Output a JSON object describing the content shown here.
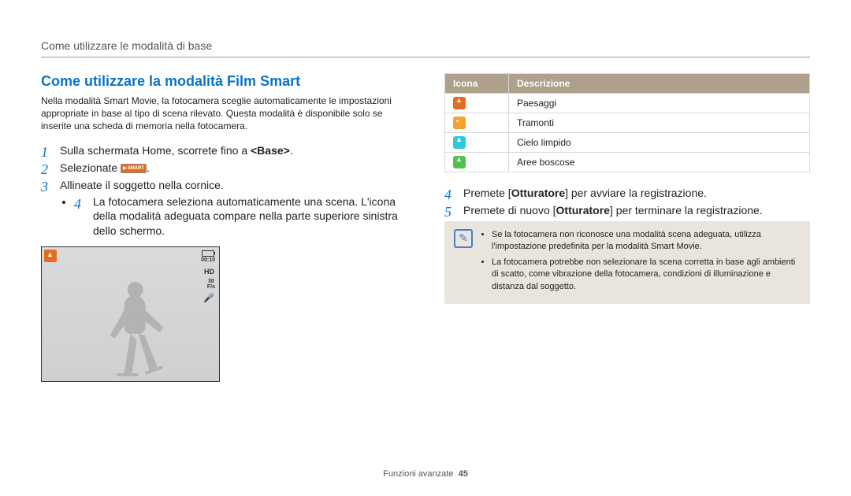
{
  "header": "Come utilizzare le modalità di base",
  "section_title": "Come utilizzare la modalità Film Smart",
  "intro": "Nella modalità Smart Movie, la fotocamera sceglie automaticamente le impostazioni appropriate in base al tipo di scena rilevato. Questa modalità è disponibile solo se inserite una scheda di memoria nella fotocamera.",
  "steps": {
    "s1_pre": "Sulla schermata Home, scorrete fino a ",
    "s1_bold": "<Base>",
    "s1_post": ".",
    "s2_pre": "Selezionate ",
    "s2_icon_label": "SMART",
    "s2_post": ".",
    "s3": "Allineate il soggetto nella cornice.",
    "s3_sub": "La fotocamera seleziona automaticamente una scena. L'icona della modalità adeguata compare nella parte superiore sinistra dello schermo.",
    "s4_pre": "Premete [",
    "s4_bold": "Otturatore",
    "s4_post": "] per avviare la registrazione.",
    "s5_pre": "Premete di nuovo [",
    "s5_bold": "Otturatore",
    "s5_post": "] per terminare la registrazione."
  },
  "camera": {
    "standby": "",
    "timecode": "00:10",
    "hd": "HD",
    "fps_val": "30",
    "fps_unit": "F/s"
  },
  "table": {
    "h1": "Icona",
    "h2": "Descrizione",
    "rows": [
      {
        "label": "Paesaggi",
        "iconClass": "mi-orange",
        "iconName": "landscape-icon"
      },
      {
        "label": "Tramonti",
        "iconClass": "mi-orange2",
        "iconName": "sunset-icon"
      },
      {
        "label": "Cielo limpido",
        "iconClass": "mi-blue",
        "iconName": "clear-sky-icon"
      },
      {
        "label": "Aree boscose",
        "iconClass": "mi-green",
        "iconName": "forest-icon"
      }
    ]
  },
  "notes": [
    "Se la fotocamera non riconosce una modalità scena adeguata, utilizza l'impostazione predefinita per la modalità Smart Movie.",
    "La fotocamera potrebbe non selezionare la scena corretta in base agli ambienti di scatto, come vibrazione della fotocamera, condizioni di illuminazione e distanza dal soggetto."
  ],
  "footer_label": "Funzioni avanzate",
  "footer_page": "45"
}
